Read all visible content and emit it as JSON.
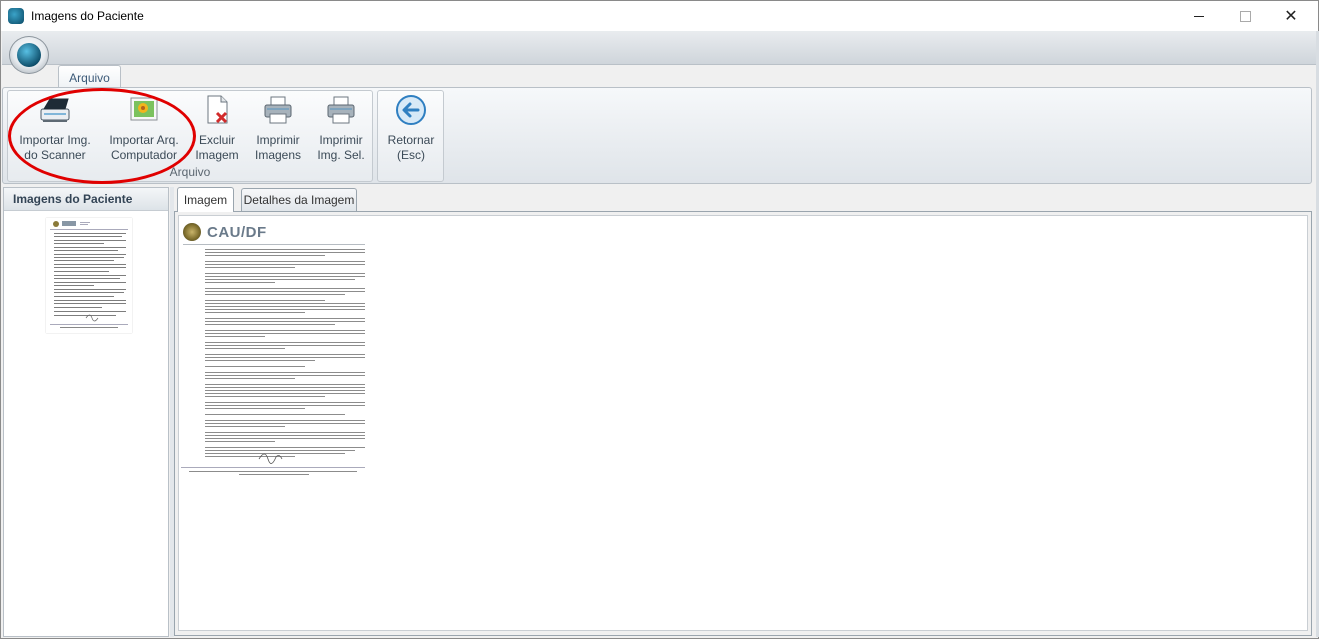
{
  "window": {
    "title": "Imagens do Paciente",
    "close_glyph": "✕"
  },
  "ribbon": {
    "tab_label": "Arquivo",
    "groups": [
      {
        "label": "Arquivo",
        "buttons": [
          {
            "label": "Importar Img.\ndo Scanner",
            "icon": "scanner-icon"
          },
          {
            "label": "Importar Arq.\nComputador",
            "icon": "image-file-icon"
          },
          {
            "label": "Excluir\nImagem",
            "icon": "delete-document-icon"
          },
          {
            "label": "Imprimir\nImagens",
            "icon": "printer-icon"
          },
          {
            "label": "Imprimir\nImg. Sel.",
            "icon": "printer-icon"
          }
        ]
      },
      {
        "label": "",
        "buttons": [
          {
            "label": "Retornar\n(Esc)",
            "icon": "back-arrow-icon"
          }
        ]
      }
    ]
  },
  "left_panel": {
    "title": "Imagens do Paciente"
  },
  "tabs": [
    {
      "label": "Imagem",
      "active": true
    },
    {
      "label": "Detalhes da Imagem",
      "active": false
    }
  ],
  "document": {
    "logo_text": "CAU/DF"
  },
  "colors": {
    "highlight_ellipse": "#e00000",
    "accent": "#0b4a66"
  }
}
